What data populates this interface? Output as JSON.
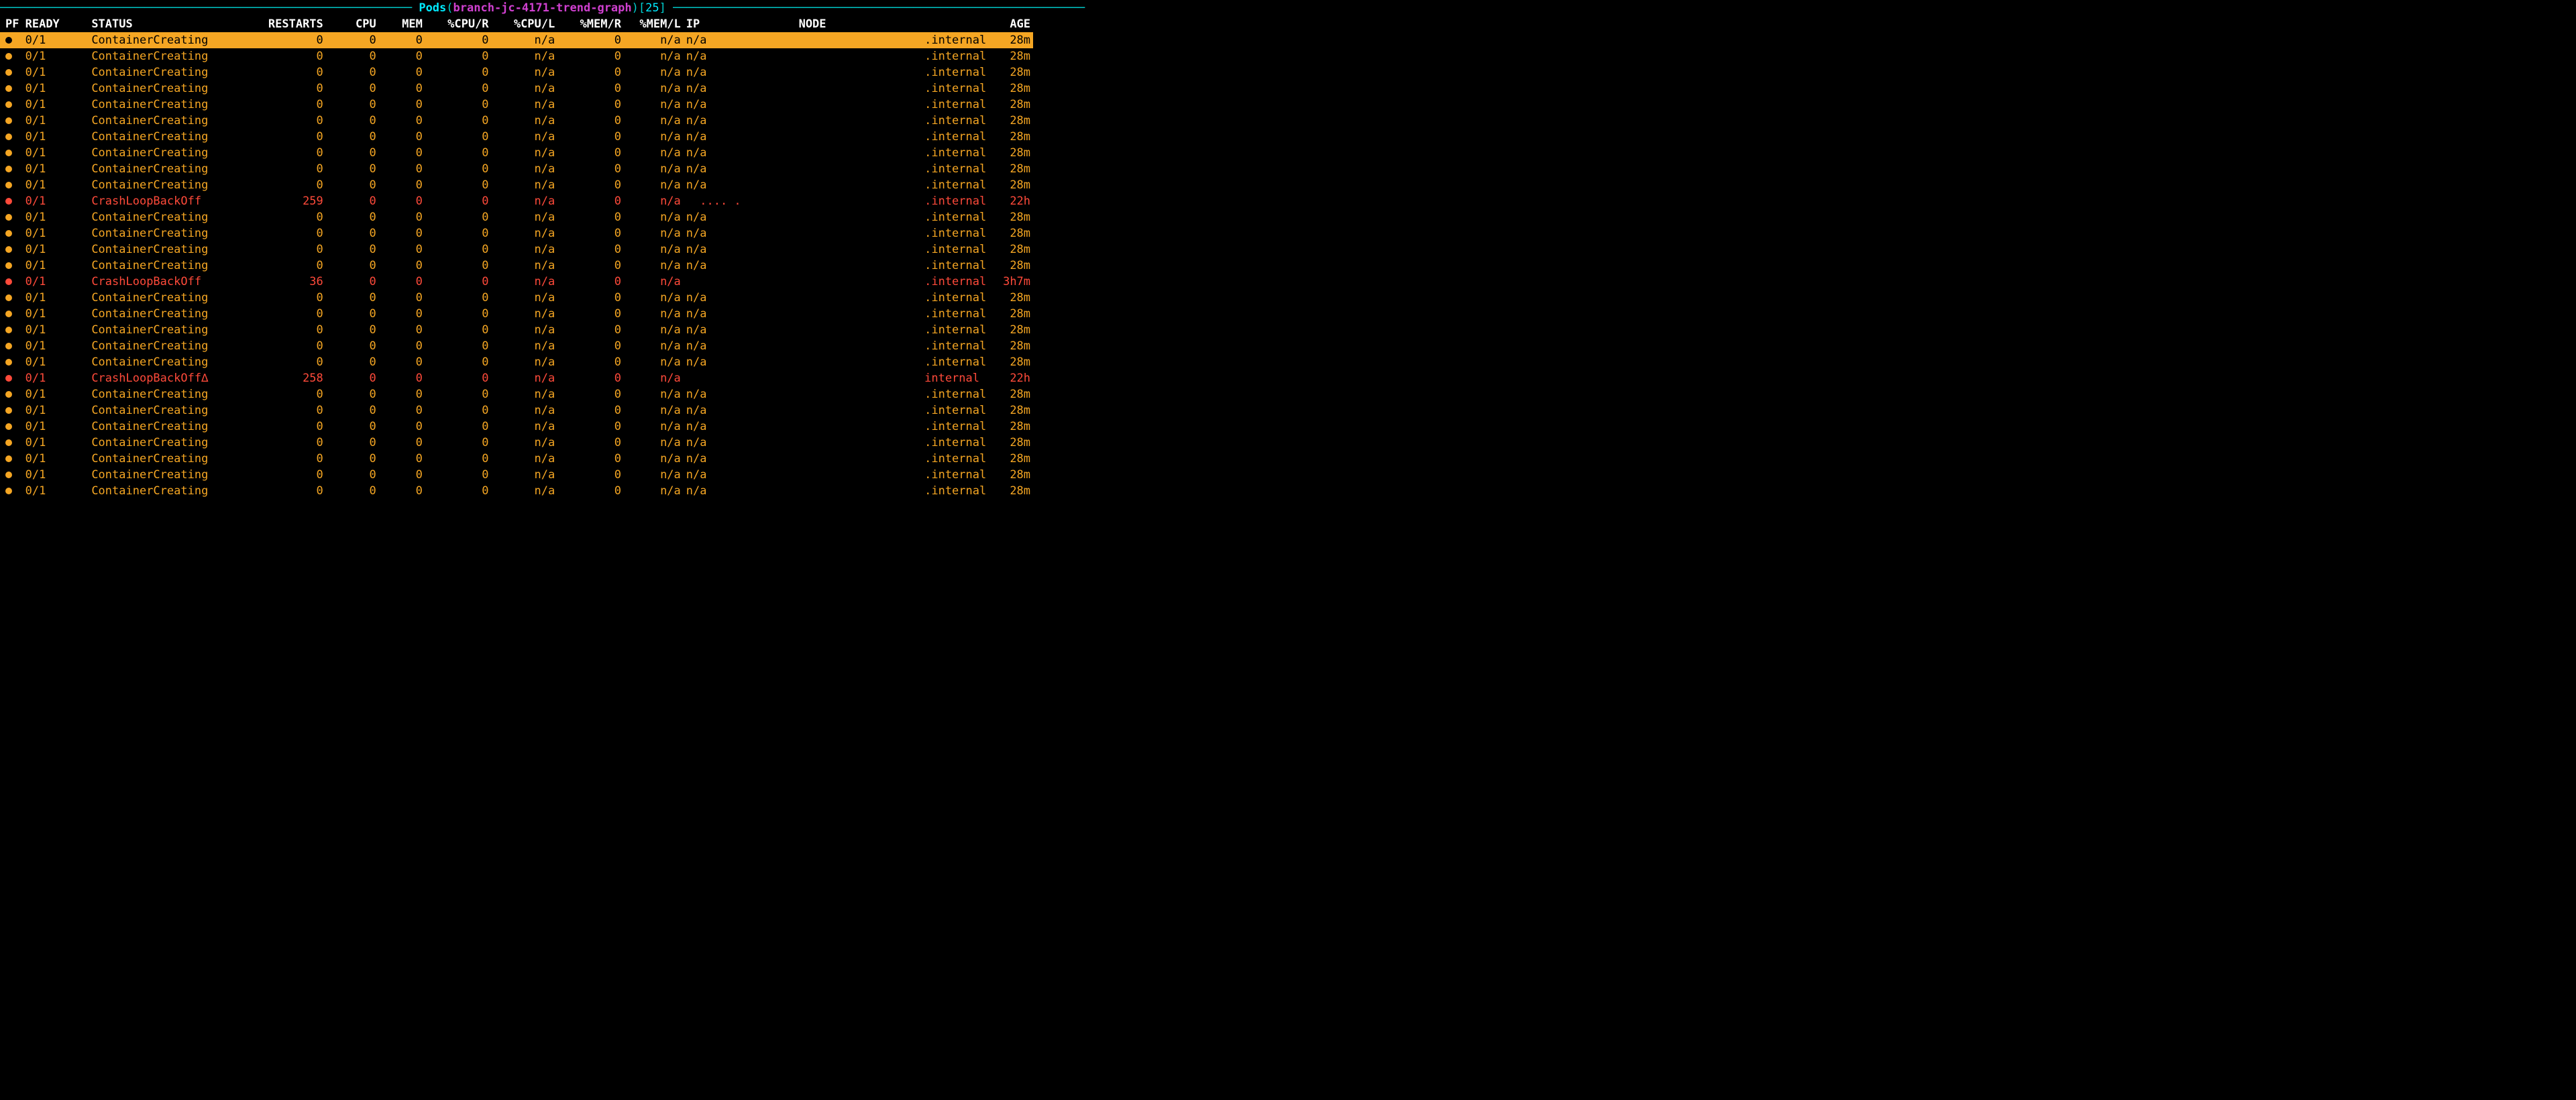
{
  "colors": {
    "orange": "#f5a623",
    "red": "#ff4a3a",
    "sel": "#f5a623"
  },
  "title": {
    "label": "Pods",
    "ns": "branch-jc-4171-trend-graph",
    "count": "25"
  },
  "headers": {
    "pf": "PF",
    "ready": "READY",
    "status": "STATUS",
    "restarts": "RESTARTS",
    "cpu": "CPU",
    "mem": "MEM",
    "cpur": "%CPU/R",
    "cpul": "%CPU/L",
    "memr": "%MEM/R",
    "meml": "%MEM/L",
    "ip": "IP",
    "node": "NODE",
    "age": "AGE"
  },
  "rows": [
    {
      "sel": true,
      "dot": "orange",
      "ready": "0/1",
      "status": "ContainerCreating",
      "cls": "orange",
      "restarts": "0",
      "cpu": "0",
      "mem": "0",
      "cpur": "0",
      "cpul": "n/a",
      "memr": "0",
      "meml": "n/a",
      "ip": "n/a",
      "internal": ".internal",
      "age": "28m"
    },
    {
      "dot": "orange",
      "ready": "0/1",
      "status": "ContainerCreating",
      "cls": "orange",
      "restarts": "0",
      "cpu": "0",
      "mem": "0",
      "cpur": "0",
      "cpul": "n/a",
      "memr": "0",
      "meml": "n/a",
      "ip": "n/a",
      "internal": ".internal",
      "age": "28m"
    },
    {
      "dot": "orange",
      "ready": "0/1",
      "status": "ContainerCreating",
      "cls": "orange",
      "restarts": "0",
      "cpu": "0",
      "mem": "0",
      "cpur": "0",
      "cpul": "n/a",
      "memr": "0",
      "meml": "n/a",
      "ip": "n/a",
      "internal": ".internal",
      "age": "28m"
    },
    {
      "dot": "orange",
      "ready": "0/1",
      "status": "ContainerCreating",
      "cls": "orange",
      "restarts": "0",
      "cpu": "0",
      "mem": "0",
      "cpur": "0",
      "cpul": "n/a",
      "memr": "0",
      "meml": "n/a",
      "ip": "n/a",
      "internal": ".internal",
      "age": "28m"
    },
    {
      "dot": "orange",
      "ready": "0/1",
      "status": "ContainerCreating",
      "cls": "orange",
      "restarts": "0",
      "cpu": "0",
      "mem": "0",
      "cpur": "0",
      "cpul": "n/a",
      "memr": "0",
      "meml": "n/a",
      "ip": "n/a",
      "internal": ".internal",
      "age": "28m"
    },
    {
      "dot": "orange",
      "ready": "0/1",
      "status": "ContainerCreating",
      "cls": "orange",
      "restarts": "0",
      "cpu": "0",
      "mem": "0",
      "cpur": "0",
      "cpul": "n/a",
      "memr": "0",
      "meml": "n/a",
      "ip": "n/a",
      "internal": ".internal",
      "age": "28m"
    },
    {
      "dot": "orange",
      "ready": "0/1",
      "status": "ContainerCreating",
      "cls": "orange",
      "restarts": "0",
      "cpu": "0",
      "mem": "0",
      "cpur": "0",
      "cpul": "n/a",
      "memr": "0",
      "meml": "n/a",
      "ip": "n/a",
      "internal": ".internal",
      "age": "28m"
    },
    {
      "dot": "orange",
      "ready": "0/1",
      "status": "ContainerCreating",
      "cls": "orange",
      "restarts": "0",
      "cpu": "0",
      "mem": "0",
      "cpur": "0",
      "cpul": "n/a",
      "memr": "0",
      "meml": "n/a",
      "ip": "n/a",
      "internal": ".internal",
      "age": "28m"
    },
    {
      "dot": "orange",
      "ready": "0/1",
      "status": "ContainerCreating",
      "cls": "orange",
      "restarts": "0",
      "cpu": "0",
      "mem": "0",
      "cpur": "0",
      "cpul": "n/a",
      "memr": "0",
      "meml": "n/a",
      "ip": "n/a",
      "internal": ".internal",
      "age": "28m"
    },
    {
      "dot": "orange",
      "ready": "0/1",
      "status": "ContainerCreating",
      "cls": "orange",
      "restarts": "0",
      "cpu": "0",
      "mem": "0",
      "cpur": "0",
      "cpul": "n/a",
      "memr": "0",
      "meml": "n/a",
      "ip": "n/a",
      "internal": ".internal",
      "age": "28m"
    },
    {
      "dot": "red",
      "ready": "0/1",
      "status": "CrashLoopBackOff",
      "cls": "red",
      "restarts": "259",
      "cpu": "0",
      "mem": "0",
      "cpur": "0",
      "cpul": "n/a",
      "memr": "0",
      "meml": "n/a",
      "ip": "  .... .",
      "internal": ".internal",
      "age": "22h"
    },
    {
      "dot": "orange",
      "ready": "0/1",
      "status": "ContainerCreating",
      "cls": "orange",
      "restarts": "0",
      "cpu": "0",
      "mem": "0",
      "cpur": "0",
      "cpul": "n/a",
      "memr": "0",
      "meml": "n/a",
      "ip": "n/a",
      "internal": ".internal",
      "age": "28m"
    },
    {
      "dot": "orange",
      "ready": "0/1",
      "status": "ContainerCreating",
      "cls": "orange",
      "restarts": "0",
      "cpu": "0",
      "mem": "0",
      "cpur": "0",
      "cpul": "n/a",
      "memr": "0",
      "meml": "n/a",
      "ip": "n/a",
      "internal": ".internal",
      "age": "28m"
    },
    {
      "dot": "orange",
      "ready": "0/1",
      "status": "ContainerCreating",
      "cls": "orange",
      "restarts": "0",
      "cpu": "0",
      "mem": "0",
      "cpur": "0",
      "cpul": "n/a",
      "memr": "0",
      "meml": "n/a",
      "ip": "n/a",
      "internal": ".internal",
      "age": "28m"
    },
    {
      "dot": "orange",
      "ready": "0/1",
      "status": "ContainerCreating",
      "cls": "orange",
      "restarts": "0",
      "cpu": "0",
      "mem": "0",
      "cpur": "0",
      "cpul": "n/a",
      "memr": "0",
      "meml": "n/a",
      "ip": "n/a",
      "internal": ".internal",
      "age": "28m"
    },
    {
      "dot": "red",
      "ready": "0/1",
      "status": "CrashLoopBackOff",
      "cls": "red",
      "restarts": "36",
      "cpu": "0",
      "mem": "0",
      "cpur": "0",
      "cpul": "n/a",
      "memr": "0",
      "meml": "n/a",
      "ip": "",
      "internal": ".internal",
      "age": "3h7m"
    },
    {
      "dot": "orange",
      "ready": "0/1",
      "status": "ContainerCreating",
      "cls": "orange",
      "restarts": "0",
      "cpu": "0",
      "mem": "0",
      "cpur": "0",
      "cpul": "n/a",
      "memr": "0",
      "meml": "n/a",
      "ip": "n/a",
      "internal": ".internal",
      "age": "28m"
    },
    {
      "dot": "orange",
      "ready": "0/1",
      "status": "ContainerCreating",
      "cls": "orange",
      "restarts": "0",
      "cpu": "0",
      "mem": "0",
      "cpur": "0",
      "cpul": "n/a",
      "memr": "0",
      "meml": "n/a",
      "ip": "n/a",
      "internal": ".internal",
      "age": "28m"
    },
    {
      "dot": "orange",
      "ready": "0/1",
      "status": "ContainerCreating",
      "cls": "orange",
      "restarts": "0",
      "cpu": "0",
      "mem": "0",
      "cpur": "0",
      "cpul": "n/a",
      "memr": "0",
      "meml": "n/a",
      "ip": "n/a",
      "internal": ".internal",
      "age": "28m"
    },
    {
      "dot": "orange",
      "ready": "0/1",
      "status": "ContainerCreating",
      "cls": "orange",
      "restarts": "0",
      "cpu": "0",
      "mem": "0",
      "cpur": "0",
      "cpul": "n/a",
      "memr": "0",
      "meml": "n/a",
      "ip": "n/a",
      "internal": ".internal",
      "age": "28m"
    },
    {
      "dot": "orange",
      "ready": "0/1",
      "status": "ContainerCreating",
      "cls": "orange",
      "restarts": "0",
      "cpu": "0",
      "mem": "0",
      "cpur": "0",
      "cpul": "n/a",
      "memr": "0",
      "meml": "n/a",
      "ip": "n/a",
      "internal": ".internal",
      "age": "28m"
    },
    {
      "dot": "red",
      "ready": "0/1",
      "status": "CrashLoopBackOff∆",
      "cls": "red",
      "restarts": "258",
      "cpu": "0",
      "mem": "0",
      "cpur": "0",
      "cpul": "n/a",
      "memr": "0",
      "meml": "n/a",
      "ip": "",
      "internal": "internal",
      "age": "22h"
    },
    {
      "dot": "orange",
      "ready": "0/1",
      "status": "ContainerCreating",
      "cls": "orange",
      "restarts": "0",
      "cpu": "0",
      "mem": "0",
      "cpur": "0",
      "cpul": "n/a",
      "memr": "0",
      "meml": "n/a",
      "ip": "n/a",
      "internal": ".internal",
      "age": "28m"
    },
    {
      "dot": "orange",
      "ready": "0/1",
      "status": "ContainerCreating",
      "cls": "orange",
      "restarts": "0",
      "cpu": "0",
      "mem": "0",
      "cpur": "0",
      "cpul": "n/a",
      "memr": "0",
      "meml": "n/a",
      "ip": "n/a",
      "internal": ".internal",
      "age": "28m"
    },
    {
      "dot": "orange",
      "ready": "0/1",
      "status": "ContainerCreating",
      "cls": "orange",
      "restarts": "0",
      "cpu": "0",
      "mem": "0",
      "cpur": "0",
      "cpul": "n/a",
      "memr": "0",
      "meml": "n/a",
      "ip": "n/a",
      "internal": ".internal",
      "age": "28m"
    },
    {
      "dot": "orange",
      "ready": "0/1",
      "status": "ContainerCreating",
      "cls": "orange",
      "restarts": "0",
      "cpu": "0",
      "mem": "0",
      "cpur": "0",
      "cpul": "n/a",
      "memr": "0",
      "meml": "n/a",
      "ip": "n/a",
      "internal": ".internal",
      "age": "28m"
    },
    {
      "dot": "orange",
      "ready": "0/1",
      "status": "ContainerCreating",
      "cls": "orange",
      "restarts": "0",
      "cpu": "0",
      "mem": "0",
      "cpur": "0",
      "cpul": "n/a",
      "memr": "0",
      "meml": "n/a",
      "ip": "n/a",
      "internal": ".internal",
      "age": "28m"
    },
    {
      "dot": "orange",
      "ready": "0/1",
      "status": "ContainerCreating",
      "cls": "orange",
      "restarts": "0",
      "cpu": "0",
      "mem": "0",
      "cpur": "0",
      "cpul": "n/a",
      "memr": "0",
      "meml": "n/a",
      "ip": "n/a",
      "internal": ".internal",
      "age": "28m"
    },
    {
      "dot": "orange",
      "ready": "0/1",
      "status": "ContainerCreating",
      "cls": "orange",
      "restarts": "0",
      "cpu": "0",
      "mem": "0",
      "cpur": "0",
      "cpul": "n/a",
      "memr": "0",
      "meml": "n/a",
      "ip": "n/a",
      "internal": ".internal",
      "age": "28m"
    }
  ]
}
